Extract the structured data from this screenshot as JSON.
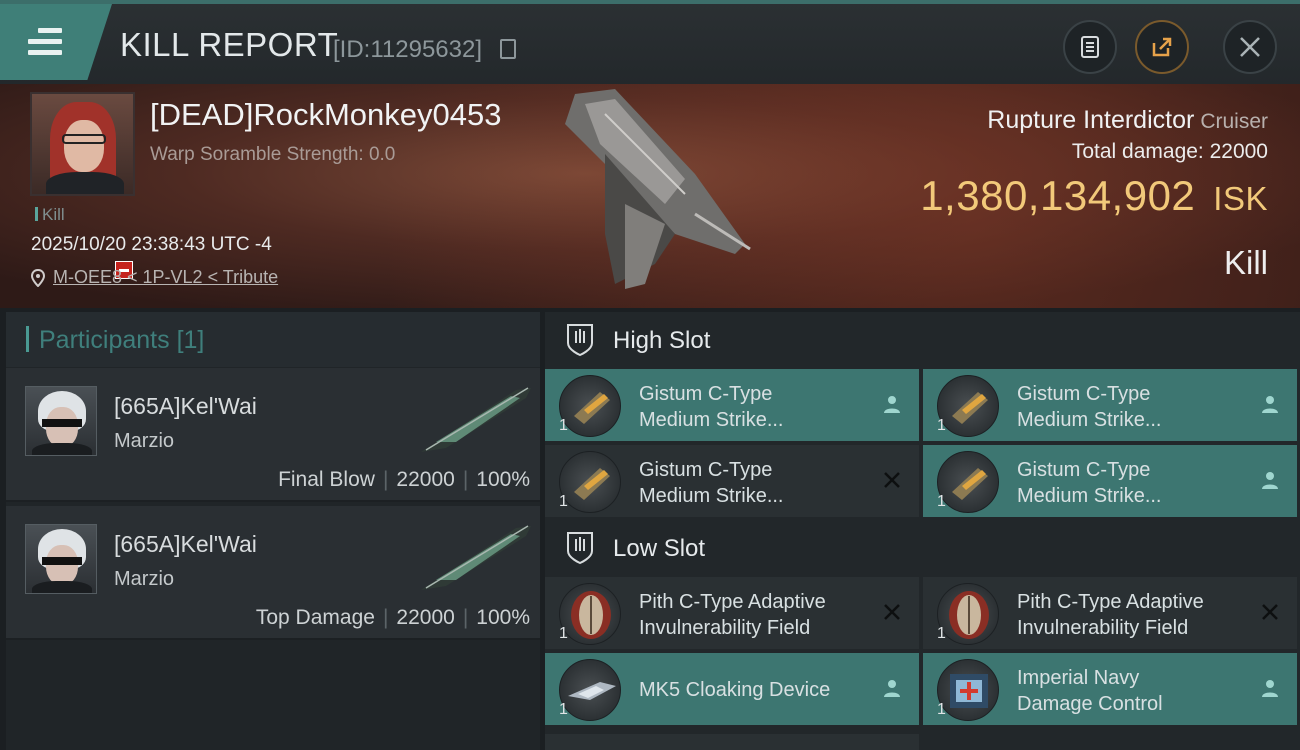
{
  "header": {
    "title": "KILL REPORT",
    "report_id": "[ID:11295632]",
    "icons": [
      "menu-icon",
      "copy-icon",
      "clipboard-icon",
      "share-icon",
      "close-icon"
    ]
  },
  "victim": {
    "name": "[DEAD]RockMonkey0453",
    "warp_scramble": "Warp Soramble Strength: 0.0",
    "kill_tag": "Kill",
    "timestamp": "2025/10/20 23:38:43 UTC -4",
    "location": "M-OEE8 < 1P-VL2 < Tribute",
    "ship_name": "Rupture Interdictor",
    "ship_class": "Cruiser",
    "total_damage": "Total damage:  22000",
    "isk_value": "1,380,134,902",
    "isk_unit": "ISK",
    "result": "Kill"
  },
  "participants": {
    "header": "Participants",
    "count": "[1]",
    "list": [
      {
        "name": "[665A]Kel'Wai",
        "corp": "Marzio",
        "role": "Final Blow",
        "damage": "22000",
        "percent": "100%"
      },
      {
        "name": "[665A]Kel'Wai",
        "corp": "Marzio",
        "role": "Top Damage",
        "damage": "22000",
        "percent": "100%"
      }
    ]
  },
  "fitting": {
    "high_slot": {
      "label": "High Slot",
      "modules": [
        {
          "line1": "Gistum C-Type",
          "line2": "Medium Strike...",
          "qty": "1",
          "status": "person-icon",
          "active": true
        },
        {
          "line1": "Gistum C-Type",
          "line2": "Medium Strike...",
          "qty": "1",
          "status": "person-icon",
          "active": true
        },
        {
          "line1": "Gistum C-Type",
          "line2": "Medium Strike...",
          "qty": "1",
          "status": "destroyed-x-icon",
          "active": false
        },
        {
          "line1": "Gistum C-Type",
          "line2": "Medium Strike...",
          "qty": "1",
          "status": "person-icon",
          "active": true
        }
      ]
    },
    "low_slot": {
      "label": "Low Slot",
      "modules": [
        {
          "line1": "Pith C-Type Adaptive",
          "line2": "Invulnerability Field",
          "qty": "1",
          "status": "destroyed-x-icon",
          "active": false
        },
        {
          "line1": "Pith C-Type Adaptive",
          "line2": "Invulnerability Field",
          "qty": "1",
          "status": "destroyed-x-icon",
          "active": false
        },
        {
          "line1": "MK5 Cloaking Device",
          "line2": "",
          "qty": "1",
          "status": "person-icon",
          "active": true
        },
        {
          "line1": "Imperial Navy",
          "line2": "Damage Control",
          "qty": "1",
          "status": "person-icon",
          "active": true
        }
      ]
    }
  },
  "colors": {
    "accent": "#3d7671",
    "isk_gold": "#f2c97a",
    "dead_red": "#c5231d"
  }
}
